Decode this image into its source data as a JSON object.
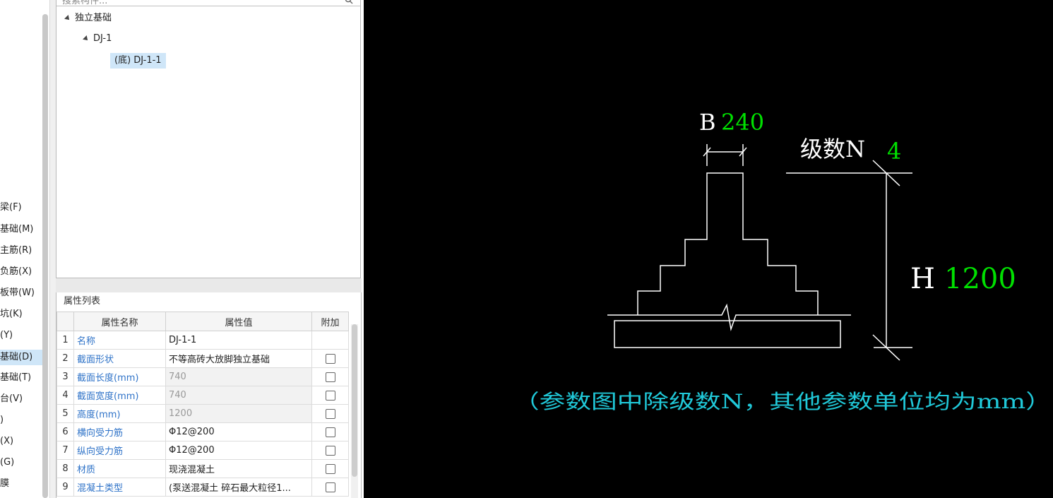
{
  "left_list": {
    "items": [
      {
        "label": "梁(F)",
        "selected": false
      },
      {
        "label": "基础(M)",
        "selected": false
      },
      {
        "label": "主筋(R)",
        "selected": false
      },
      {
        "label": "负筋(X)",
        "selected": false
      },
      {
        "label": "板带(W)",
        "selected": false
      },
      {
        "label": "坑(K)",
        "selected": false
      },
      {
        "label": "(Y)",
        "selected": false
      },
      {
        "label": "基础(D)",
        "selected": true
      },
      {
        "label": "基础(T)",
        "selected": false
      },
      {
        "label": "台(V)",
        "selected": false
      },
      {
        "label": ")",
        "selected": false
      },
      {
        "label": "(X)",
        "selected": false
      },
      {
        "label": "(G)",
        "selected": false
      },
      {
        "label": "膜",
        "selected": false
      }
    ]
  },
  "search": {
    "placeholder": "搜索构件..."
  },
  "tree": {
    "root": "独立基础",
    "child": "DJ-1",
    "leaf": "(底) DJ-1-1"
  },
  "properties": {
    "title": "属性列表",
    "headers": {
      "name": "属性名称",
      "value": "属性值",
      "extra": "附加"
    },
    "rows": [
      {
        "num": "1",
        "name": "名称",
        "value": "DJ-1-1",
        "readonly": false,
        "checkbox": false
      },
      {
        "num": "2",
        "name": "截面形状",
        "value": "不等高砖大放脚独立基础",
        "readonly": false,
        "checkbox": true
      },
      {
        "num": "3",
        "name": "截面长度(mm)",
        "value": "740",
        "readonly": true,
        "checkbox": true
      },
      {
        "num": "4",
        "name": "截面宽度(mm)",
        "value": "740",
        "readonly": true,
        "checkbox": true
      },
      {
        "num": "5",
        "name": "高度(mm)",
        "value": "1200",
        "readonly": true,
        "checkbox": true
      },
      {
        "num": "6",
        "name": "横向受力筋",
        "value": "Φ12@200",
        "readonly": false,
        "checkbox": true
      },
      {
        "num": "7",
        "name": "纵向受力筋",
        "value": "Φ12@200",
        "readonly": false,
        "checkbox": true
      },
      {
        "num": "8",
        "name": "材质",
        "value": "现浇混凝土",
        "readonly": false,
        "checkbox": true
      },
      {
        "num": "9",
        "name": "混凝土类型",
        "value": "(泵送混凝土 碎石最大粒径1...",
        "readonly": false,
        "checkbox": true
      }
    ]
  },
  "drawing": {
    "b_label": "B",
    "b_value": "240",
    "n_label": "级数N",
    "n_value": "4",
    "h_label": "H",
    "h_value": "1200",
    "note": "（参数图中除级数N，其他参数单位均为mm）",
    "colors": {
      "line": "#ffffff",
      "value": "#00e000",
      "note": "#20c8d8",
      "background": "#000000"
    }
  }
}
